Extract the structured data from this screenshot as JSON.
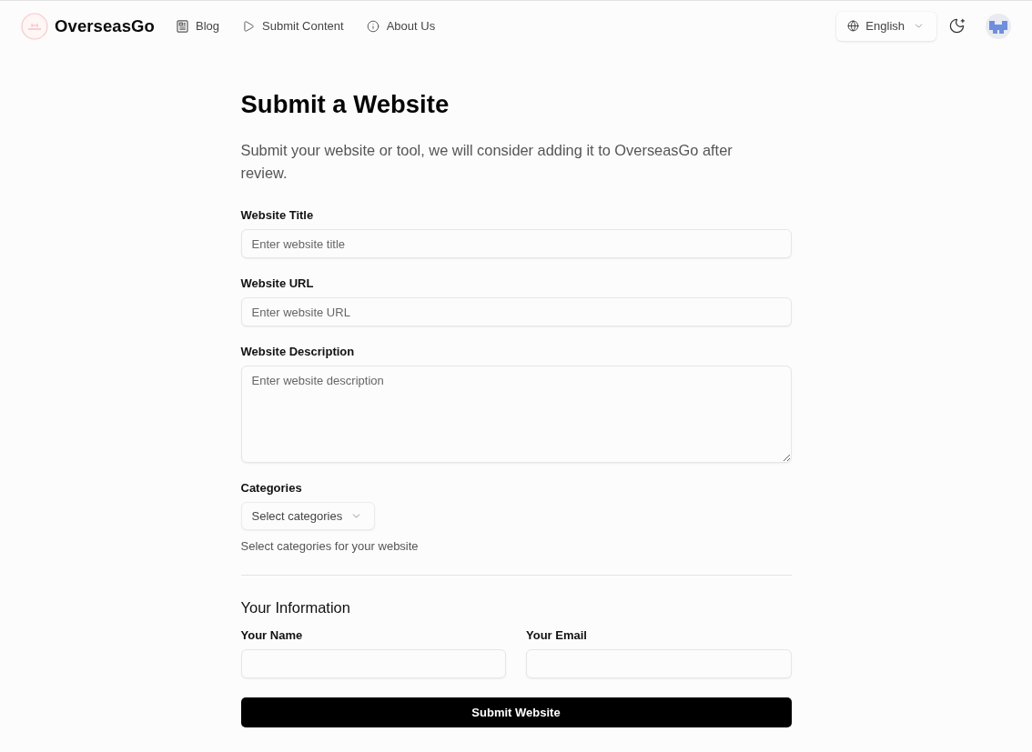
{
  "header": {
    "brand": "OverseasGo",
    "nav": [
      {
        "label": "Blog",
        "kind": "document"
      },
      {
        "label": "Submit Content",
        "kind": "play"
      },
      {
        "label": "About Us",
        "kind": "info"
      }
    ],
    "language": "English"
  },
  "page": {
    "title": "Submit a Website",
    "subtitle": "Submit your website or tool, we will consider adding it to OverseasGo after review.",
    "fields": [
      {
        "label": "Website Title",
        "kind": "input",
        "placeholder": "Enter website title"
      },
      {
        "label": "Website URL",
        "kind": "input",
        "placeholder": "Enter website URL"
      },
      {
        "label": "Website Description",
        "kind": "textarea",
        "placeholder": "Enter website description"
      }
    ],
    "categories": {
      "label": "Categories",
      "placeholder": "Select categories",
      "hint": "Select categories for your website"
    },
    "your_information": {
      "heading": "Your Information",
      "fields": [
        {
          "label": "Your Name"
        },
        {
          "label": "Your Email"
        }
      ]
    },
    "submit": "Submit Website"
  }
}
